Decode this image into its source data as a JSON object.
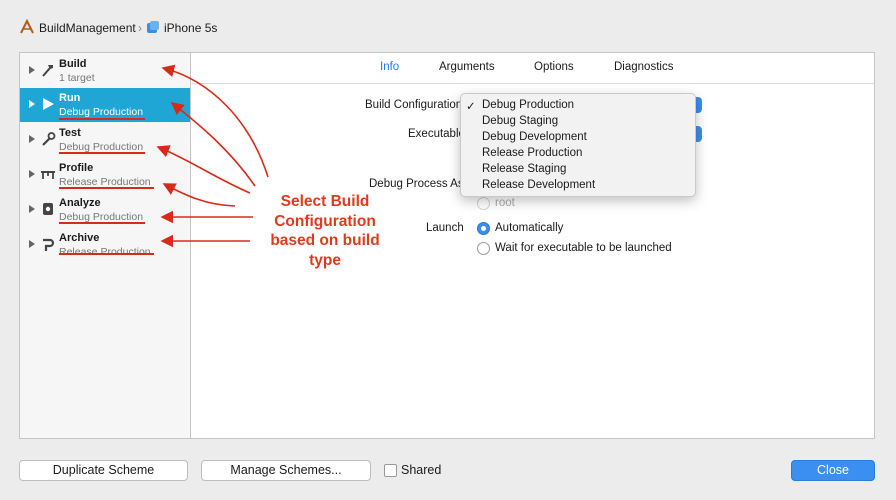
{
  "breadcrumb": {
    "project": "BuildManagement",
    "device": "iPhone 5s",
    "separator": "›"
  },
  "sidebar": {
    "items": [
      {
        "name": "Build",
        "sub": "1 target",
        "icon": "hammer-icon"
      },
      {
        "name": "Run",
        "sub": "Debug Production",
        "icon": "play-icon"
      },
      {
        "name": "Test",
        "sub": "Debug Production",
        "icon": "wrench-icon"
      },
      {
        "name": "Profile",
        "sub": "Release Production",
        "icon": "instruments-icon"
      },
      {
        "name": "Analyze",
        "sub": "Debug Production",
        "icon": "analyze-icon"
      },
      {
        "name": "Archive",
        "sub": "Release Production",
        "icon": "archive-icon"
      }
    ]
  },
  "tabs": [
    "Info",
    "Arguments",
    "Options",
    "Diagnostics"
  ],
  "form": {
    "build_configuration_label": "Build Configuration",
    "executable_label": "Executable",
    "debug_process_label": "Debug Process As",
    "root_label": "root",
    "launch_label": "Launch",
    "launch_auto": "Automatically",
    "launch_wait": "Wait for executable to be launched"
  },
  "dropdown": {
    "selected": "Debug Production",
    "check": "✓",
    "options": [
      "Debug Production",
      "Debug Staging",
      "Debug Development",
      "Release Production",
      "Release Staging",
      "Release Development"
    ]
  },
  "annotation": {
    "text_lines": [
      "Select Build",
      "Configuration",
      "based on build",
      "type"
    ],
    "color": "#e03a1e"
  },
  "footer": {
    "duplicate": "Duplicate Scheme",
    "manage": "Manage Schemes...",
    "shared": "Shared",
    "close": "Close"
  },
  "colors": {
    "accent": "#1fa6d4",
    "button_primary": "#3a8ff0",
    "annotation": "#e03a1e"
  }
}
